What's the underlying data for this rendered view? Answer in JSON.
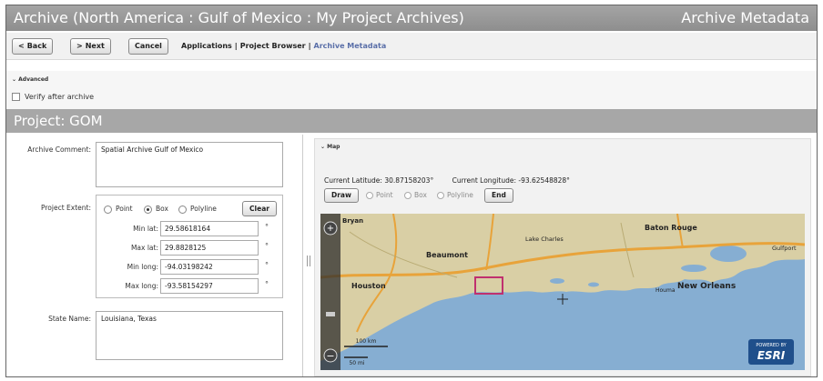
{
  "window": {
    "title": "Archive (North America : Gulf of Mexico : My Project Archives)",
    "page_title": "Archive Metadata"
  },
  "toolbar": {
    "back_label": "Back",
    "next_label": "Next",
    "cancel_label": "Cancel",
    "breadcrumbs": [
      "Applications",
      "Project Browser",
      "Archive Metadata"
    ],
    "breadcrumb_separator": "|"
  },
  "advanced": {
    "header": "Advanced",
    "verify_label": "Verify after archive",
    "verify_checked": false
  },
  "project": {
    "title": "Project: GOM"
  },
  "form": {
    "archive_comment_label": "Archive Comment:",
    "archive_comment_value": "Spatial Archive Gulf of Mexico",
    "project_extent_label": "Project Extent:",
    "extent_options": [
      "Point",
      "Box",
      "Polyline"
    ],
    "extent_selected": "Box",
    "clear_label": "Clear",
    "degree_symbol": "°",
    "coordinates": [
      {
        "label": "Min lat:",
        "value": "29.58618164"
      },
      {
        "label": "Max lat:",
        "value": "29.8828125"
      },
      {
        "label": "Min long:",
        "value": "-94.03198242"
      },
      {
        "label": "Max long:",
        "value": "-93.58154297"
      }
    ],
    "state_name_label": "State Name:",
    "state_name_value": "Louisiana, Texas"
  },
  "map": {
    "header": "Map",
    "current_latitude_label": "Current Latitude:",
    "current_latitude_value": "30.87158203°",
    "current_longitude_label": "Current Longitude:",
    "current_longitude_value": "-93.62548828°",
    "draw_label": "Draw",
    "draw_options": [
      "Point",
      "Box",
      "Polyline"
    ],
    "end_label": "End",
    "places": [
      "Bryan",
      "Beaumont",
      "Lake Charles",
      "Baton Rouge",
      "Houston",
      "New Orleans",
      "Houma",
      "Gulfport"
    ],
    "scale_km": "100 km",
    "scale_mi": "50 mi",
    "brand_top": "POWERED BY",
    "brand_name": "ESRI",
    "colors": {
      "land": "#d9cfa5",
      "water": "#86aed2",
      "highway": "#e8a33a",
      "selection": "#c0306e"
    }
  }
}
